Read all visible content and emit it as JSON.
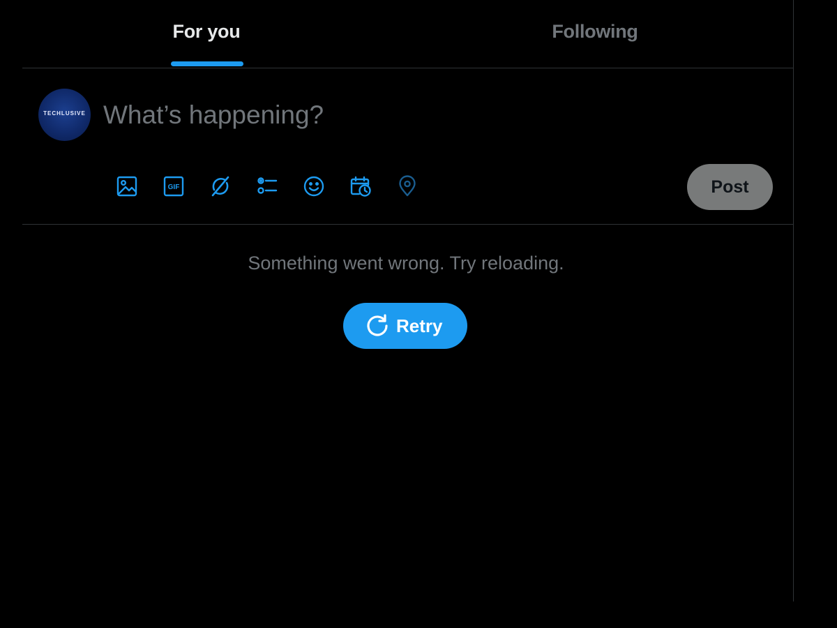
{
  "tabs": {
    "for_you": "For you",
    "following": "Following",
    "active": "for_you"
  },
  "composer": {
    "avatar_text": "TECHLUSIVE",
    "placeholder": "What’s happening?",
    "tools": [
      {
        "icon": "image-icon"
      },
      {
        "icon": "gif-icon",
        "label": "GIF"
      },
      {
        "icon": "grok-icon"
      },
      {
        "icon": "poll-icon"
      },
      {
        "icon": "emoji-icon"
      },
      {
        "icon": "schedule-icon"
      },
      {
        "icon": "location-icon"
      }
    ],
    "post_label": "Post"
  },
  "feed": {
    "error_message": "Something went wrong. Try reloading.",
    "retry_label": "Retry"
  },
  "colors": {
    "background": "#000000",
    "accent": "#1d9bf0",
    "text_primary": "#e7e9ea",
    "text_secondary": "#71767b",
    "divider": "#2f3336",
    "post_button_disabled": "#787a7a"
  }
}
